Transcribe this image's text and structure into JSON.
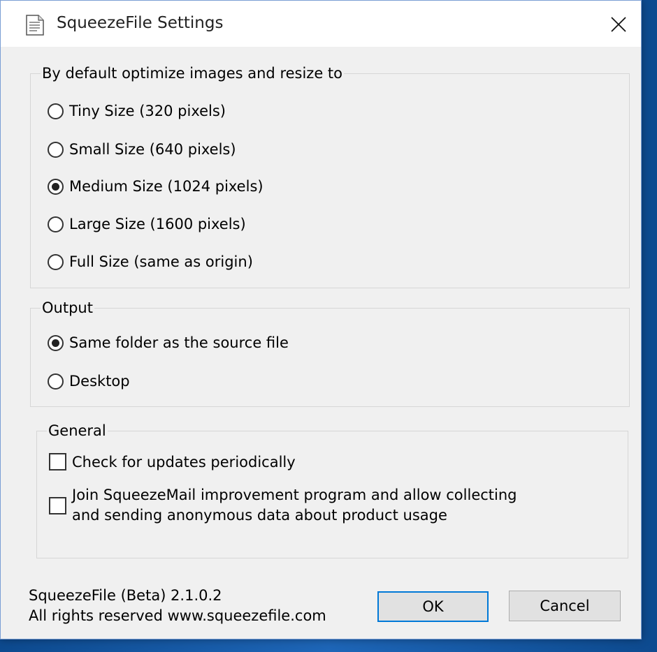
{
  "window": {
    "title": "SqueezeFile Settings",
    "app_icon": "document-icon",
    "close_icon": "close-icon",
    "accent": "#0078d7"
  },
  "resize_group": {
    "legend": "By default optimize images and resize to",
    "options": [
      {
        "label": "Tiny Size (320 pixels)",
        "checked": false
      },
      {
        "label": "Small Size (640 pixels)",
        "checked": false
      },
      {
        "label": "Medium Size (1024 pixels)",
        "checked": true
      },
      {
        "label": "Large Size (1600 pixels)",
        "checked": false
      },
      {
        "label": "Full Size (same as origin)",
        "checked": false
      }
    ]
  },
  "output_group": {
    "legend": "Output",
    "options": [
      {
        "label": "Same folder as the source file",
        "checked": true
      },
      {
        "label": "Desktop",
        "checked": false
      }
    ]
  },
  "general_group": {
    "legend": "General",
    "options": [
      {
        "label": "Check for updates periodically",
        "checked": false
      },
      {
        "label": "Join SqueezeMail improvement program and allow collecting and sending anonymous data about product usage",
        "checked": false
      }
    ]
  },
  "footer": {
    "version": "SqueezeFile (Beta) 2.1.0.2",
    "copyright": "All rights reserved www.squeezefile.com",
    "ok_label": "OK",
    "cancel_label": "Cancel"
  }
}
